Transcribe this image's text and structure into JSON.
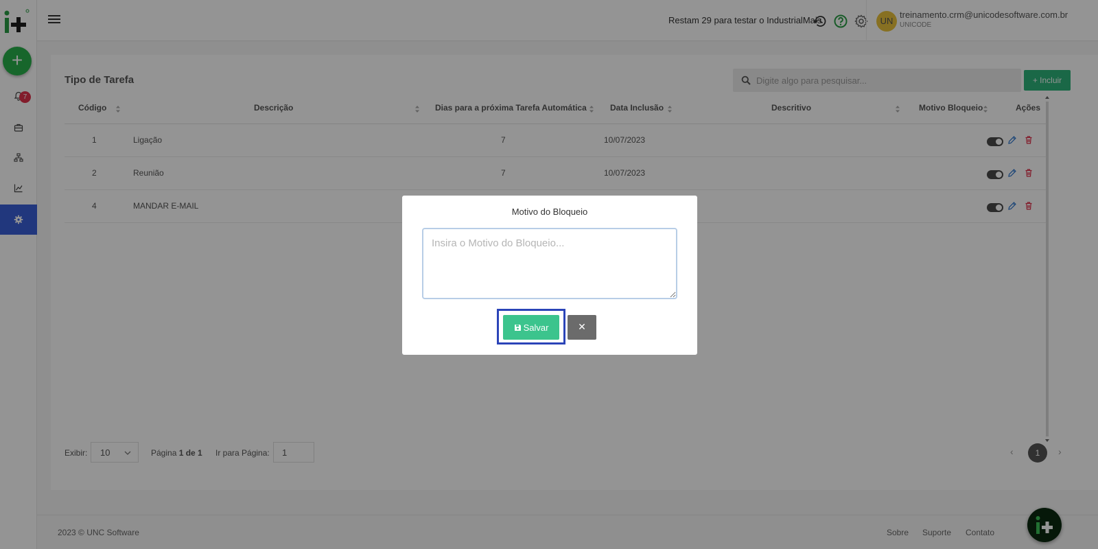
{
  "topbar": {
    "trial_text": "Restam 29 para testar o IndustrialMais",
    "user_initials": "UN",
    "user_email": "treinamento.crm@unicodesoftware.com.br",
    "user_company": "UNICODE"
  },
  "sidebar": {
    "notification_count": "7",
    "add_label": "+"
  },
  "page": {
    "title": "Tipo de Tarefa",
    "search_placeholder": "Digite algo para pesquisar...",
    "include_label": "+ Incluir"
  },
  "table": {
    "columns": [
      "Código",
      "Descrição",
      "Dias para a próxima Tarefa Automática",
      "Data Inclusão",
      "Descritivo",
      "Motivo Bloqueio",
      "Ações"
    ],
    "rows": [
      {
        "codigo": "1",
        "descricao": "Ligação",
        "dias": "7",
        "data": "10/07/2023"
      },
      {
        "codigo": "2",
        "descricao": "Reunião",
        "dias": "7",
        "data": "10/07/2023"
      },
      {
        "codigo": "4",
        "descricao": "MANDAR E-MAIL",
        "dias": "",
        "data": ""
      }
    ]
  },
  "pagination": {
    "show_label": "Exibir:",
    "page_size": "10",
    "page_label_prefix": "Página ",
    "page_info": "1 de 1",
    "goto_label": "Ir para Página:",
    "goto_value": "1",
    "current_page": "1",
    "prev": "‹",
    "next": "›"
  },
  "footer": {
    "copyright": "2023 © UNC Software",
    "links": [
      "Sobre",
      "Suporte",
      "Contato"
    ]
  },
  "modal": {
    "title": "Motivo do Bloqueio",
    "placeholder": "Insira o Motivo do Bloqueio...",
    "save_label": "Salvar",
    "close_label": "✕"
  },
  "colors": {
    "primary_green": "#2db37a",
    "save_green": "#3cc48d",
    "active_sidebar": "#3a5fd8",
    "badge_red": "#e0314b",
    "highlight_border": "#2b44b8"
  }
}
